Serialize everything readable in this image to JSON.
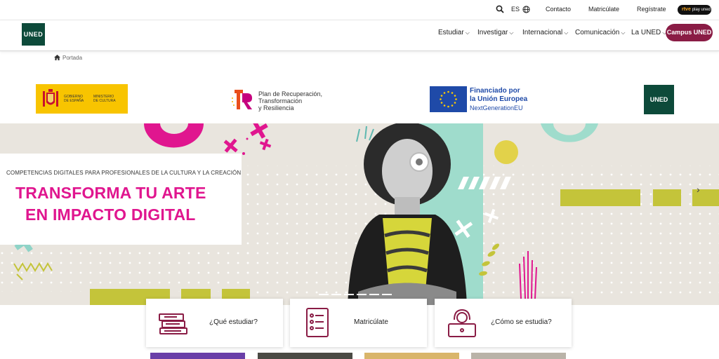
{
  "topbar": {
    "language": "ES",
    "contact": "Contacto",
    "enroll": "Matricúlate",
    "register": "Regístrate",
    "rtve_label": "rtve",
    "rtve_sub": "play uned"
  },
  "header": {
    "logo": "UNED",
    "nav": [
      {
        "label": "Estudiar"
      },
      {
        "label": "Investigar"
      },
      {
        "label": "Internacional"
      },
      {
        "label": "Comunicación"
      },
      {
        "label": "La UNED"
      }
    ],
    "campus_button": "Campus UNED"
  },
  "breadcrumb": {
    "home": "Portada"
  },
  "sponsors": {
    "gobierno_1": "GOBIERNO\nDE ESPAÑA",
    "gobierno_2": "MINISTERIO\nDE CULTURA",
    "plan_line1": "Plan de Recuperación,",
    "plan_line2": "Transformación",
    "plan_line3": "y Resiliencia",
    "eu_line1": "Financiado por",
    "eu_line2": "la Unión Europea",
    "eu_line3": "NextGenerationEU",
    "uned_logo": "UNED"
  },
  "hero": {
    "subtitle": "COMPETENCIAS DIGITALES PARA PROFESIONALES DE LA CULTURA Y LA CREACIÓN",
    "title_line1": "TRANSFORMA TU ARTE",
    "title_line2": "EN IMPACTO DIGITAL",
    "next_icon": "chevron-right-icon"
  },
  "cards": [
    {
      "label": "¿Qué estudiar?",
      "icon": "books-icon"
    },
    {
      "label": "Matricúlate",
      "icon": "form-document-icon"
    },
    {
      "label": "¿Cómo se estudia?",
      "icon": "student-laptop-icon"
    }
  ],
  "colors": {
    "brand_green": "#0d4a3a",
    "accent_magenta": "#e0168f",
    "campus_burgundy": "#8a1c45",
    "lime": "#c4c43a",
    "mint": "#9fdccc"
  }
}
